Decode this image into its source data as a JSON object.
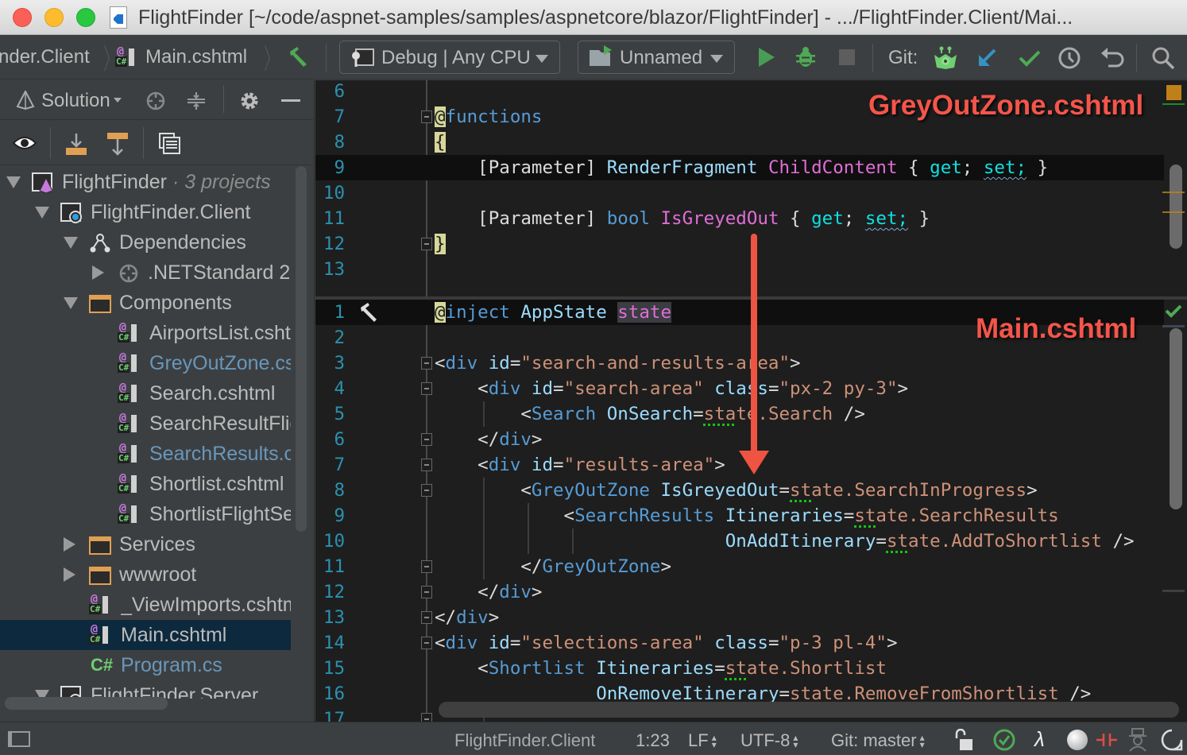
{
  "window": {
    "title": "FlightFinder [~/code/aspnet-samples/samples/aspnetcore/blazor/FlightFinder] - .../FlightFinder.Client/Mai..."
  },
  "toolbar": {
    "breadcrumbs": [
      "nder.Client",
      "Main.cshtml"
    ],
    "build_config": "Debug | Any CPU",
    "run_config": "Unnamed",
    "git_label": "Git:",
    "icons": [
      "build-hammer-icon",
      "run-icon",
      "debug-bug-icon",
      "stop-icon",
      "git-fetch-icon",
      "git-update-icon",
      "git-commit-icon",
      "git-history-icon",
      "git-revert-icon",
      "search-icon"
    ]
  },
  "solution_panel": {
    "title": "Solution",
    "tree": [
      {
        "label": "FlightFinder",
        "suffix": " · 3 projects",
        "level": 0,
        "arrow": "down",
        "icon": "solution-icon"
      },
      {
        "label": "FlightFinder.Client",
        "level": 1,
        "arrow": "down",
        "icon": "project-icon"
      },
      {
        "label": "Dependencies",
        "level": 2,
        "arrow": "down",
        "icon": "dependencies-icon"
      },
      {
        "label": ".NETStandard 2",
        "level": 3,
        "arrow": "right",
        "icon": "framework-icon"
      },
      {
        "label": "Components",
        "level": 2,
        "arrow": "down",
        "icon": "folder-icon"
      },
      {
        "label": "AirportsList.cshtml",
        "level": 4,
        "icon": "razor-file-icon"
      },
      {
        "label": "GreyOutZone.cshtml",
        "level": 4,
        "icon": "razor-file-icon",
        "modified": true
      },
      {
        "label": "Search.cshtml",
        "level": 4,
        "icon": "razor-file-icon"
      },
      {
        "label": "SearchResultFlight.cshtml",
        "level": 4,
        "icon": "razor-file-icon"
      },
      {
        "label": "SearchResults.cshtml",
        "level": 4,
        "icon": "razor-file-icon",
        "modified": true
      },
      {
        "label": "Shortlist.cshtml",
        "level": 4,
        "icon": "razor-file-icon"
      },
      {
        "label": "ShortlistFlightSegment.cshtml",
        "level": 4,
        "icon": "razor-file-icon"
      },
      {
        "label": "Services",
        "level": 2,
        "arrow": "right",
        "icon": "folder-icon"
      },
      {
        "label": "wwwroot",
        "level": 2,
        "arrow": "right",
        "icon": "folder-icon"
      },
      {
        "label": "_ViewImports.cshtml",
        "level": 3,
        "icon": "razor-file-icon"
      },
      {
        "label": "Main.cshtml",
        "level": 3,
        "icon": "razor-file-icon",
        "selected": true
      },
      {
        "label": "Program.cs",
        "level": 3,
        "icon": "csharp-file-icon",
        "modified": true
      },
      {
        "label": "FlightFinder.Server",
        "level": 1,
        "arrow": "down",
        "icon": "project-icon"
      }
    ]
  },
  "editor": {
    "top_pane": {
      "annotation": "GreyOutZone.cshtml",
      "lines": [
        {
          "n": "6",
          "tokens": []
        },
        {
          "n": "7",
          "fold": true,
          "tokens": [
            [
              "at",
              "@"
            ],
            [
              "kw",
              "functions"
            ]
          ]
        },
        {
          "n": "8",
          "tokens": [
            [
              "at",
              "{"
            ]
          ]
        },
        {
          "n": "9",
          "current": true,
          "tokens": [
            [
              "plain",
              "    [Parameter] "
            ],
            [
              "attr",
              "RenderFragment "
            ],
            [
              "pink",
              "ChildContent"
            ],
            [
              "plain",
              " { "
            ],
            [
              "cyan",
              "get"
            ],
            [
              "plain",
              "; "
            ],
            [
              "cyanwavy",
              "set;"
            ],
            [
              "plain",
              " }"
            ]
          ]
        },
        {
          "n": "10",
          "tokens": []
        },
        {
          "n": "11",
          "tokens": [
            [
              "plain",
              "    [Parameter] "
            ],
            [
              "kw",
              "bool "
            ],
            [
              "pink",
              "IsGreyedOut"
            ],
            [
              "plain",
              " { "
            ],
            [
              "cyan",
              "get"
            ],
            [
              "plain",
              "; "
            ],
            [
              "cyanwavy",
              "set;"
            ],
            [
              "plain",
              " }"
            ]
          ]
        },
        {
          "n": "12",
          "fold": true,
          "tokens": [
            [
              "at",
              "}"
            ]
          ]
        },
        {
          "n": "13",
          "tokens": []
        }
      ]
    },
    "bottom_pane": {
      "annotation": "Main.cshtml",
      "lines": [
        {
          "n": "1",
          "current": true,
          "hammer": true,
          "tokens": [
            [
              "at",
              "@"
            ],
            [
              "kw",
              "inject "
            ],
            [
              "attr",
              "AppState "
            ],
            [
              "pinkhl",
              "state"
            ]
          ]
        },
        {
          "n": "2",
          "tokens": []
        },
        {
          "n": "3",
          "fold": true,
          "tokens": [
            [
              "plain",
              "<"
            ],
            [
              "tag",
              "div "
            ],
            [
              "attr",
              "id"
            ],
            [
              "plain",
              "="
            ],
            [
              "str",
              "\"search-and-results-area\""
            ],
            [
              "plain",
              ">"
            ]
          ]
        },
        {
          "n": "4",
          "fold": true,
          "tokens": [
            [
              "plain",
              "    <"
            ],
            [
              "tag",
              "div "
            ],
            [
              "attr",
              "id"
            ],
            [
              "plain",
              "="
            ],
            [
              "str",
              "\"search-area\" "
            ],
            [
              "attr",
              "class"
            ],
            [
              "plain",
              "="
            ],
            [
              "str",
              "\"px-2 py-3\""
            ],
            [
              "plain",
              ">"
            ]
          ]
        },
        {
          "n": "5",
          "tokens": [
            [
              "plain",
              "        <"
            ],
            [
              "tag",
              "Search "
            ],
            [
              "attr",
              "OnSearch"
            ],
            [
              "plain",
              "="
            ],
            [
              "exprdot",
              "sta"
            ],
            [
              "expr",
              "te.Search "
            ],
            [
              "plain",
              "/>"
            ]
          ]
        },
        {
          "n": "6",
          "fold": true,
          "tokens": [
            [
              "plain",
              "    </"
            ],
            [
              "tag",
              "div"
            ],
            [
              "plain",
              ">"
            ]
          ]
        },
        {
          "n": "7",
          "fold": true,
          "tokens": [
            [
              "plain",
              "    <"
            ],
            [
              "tag",
              "div "
            ],
            [
              "attr",
              "id"
            ],
            [
              "plain",
              "="
            ],
            [
              "str",
              "\"results-area\""
            ],
            [
              "plain",
              ">"
            ]
          ]
        },
        {
          "n": "8",
          "fold": true,
          "tokens": [
            [
              "plain",
              "        <"
            ],
            [
              "tag",
              "GreyOutZone "
            ],
            [
              "attr",
              "IsGreyedOut"
            ],
            [
              "plain",
              "="
            ],
            [
              "exprdot",
              "st"
            ],
            [
              "expr",
              "ate.SearchInProgress"
            ],
            [
              "plain",
              ">"
            ]
          ]
        },
        {
          "n": "9",
          "tokens": [
            [
              "plain",
              "            <"
            ],
            [
              "tag",
              "SearchResults "
            ],
            [
              "attr",
              "Itineraries"
            ],
            [
              "plain",
              "="
            ],
            [
              "exprdot",
              "st"
            ],
            [
              "expr",
              "ate.SearchResults"
            ]
          ]
        },
        {
          "n": "10",
          "tokens": [
            [
              "plain",
              "                           "
            ],
            [
              "attr",
              "OnAddItinerary"
            ],
            [
              "plain",
              "="
            ],
            [
              "exprdot",
              "st"
            ],
            [
              "expr",
              "ate.AddToShortlist "
            ],
            [
              "plain",
              "/>"
            ]
          ]
        },
        {
          "n": "11",
          "fold": true,
          "tokens": [
            [
              "plain",
              "        </"
            ],
            [
              "tag",
              "GreyOutZone"
            ],
            [
              "plain",
              ">"
            ]
          ]
        },
        {
          "n": "12",
          "fold": true,
          "tokens": [
            [
              "plain",
              "    </"
            ],
            [
              "tag",
              "div"
            ],
            [
              "plain",
              ">"
            ]
          ]
        },
        {
          "n": "13",
          "fold": true,
          "tokens": [
            [
              "plain",
              "</"
            ],
            [
              "tag",
              "div"
            ],
            [
              "plain",
              ">"
            ]
          ]
        },
        {
          "n": "14",
          "fold": true,
          "tokens": [
            [
              "plain",
              "<"
            ],
            [
              "tag",
              "div "
            ],
            [
              "attr",
              "id"
            ],
            [
              "plain",
              "="
            ],
            [
              "str",
              "\"selections-area\" "
            ],
            [
              "attr",
              "class"
            ],
            [
              "plain",
              "="
            ],
            [
              "str",
              "\"p-3 pl-4\""
            ],
            [
              "plain",
              ">"
            ]
          ]
        },
        {
          "n": "15",
          "tokens": [
            [
              "plain",
              "    <"
            ],
            [
              "tag",
              "Shortlist "
            ],
            [
              "attr",
              "Itineraries"
            ],
            [
              "plain",
              "="
            ],
            [
              "exprdot",
              "st"
            ],
            [
              "expr",
              "ate.Shortlist"
            ]
          ]
        },
        {
          "n": "16",
          "tokens": [
            [
              "plain",
              "               "
            ],
            [
              "attr",
              "OnRemoveItinerary"
            ],
            [
              "plain",
              "="
            ],
            [
              "expr",
              "state.RemoveFromShortlist "
            ],
            [
              "plain",
              "/>"
            ]
          ]
        },
        {
          "n": "17",
          "fold": true,
          "tokens": []
        }
      ]
    }
  },
  "statusbar": {
    "project": "FlightFinder.Client",
    "position": "1:23",
    "line_ending": "LF",
    "encoding": "UTF-8",
    "git_branch": "Git: master",
    "icons": [
      "lock-icon",
      "inspection-ok-icon",
      "lambda-icon",
      "status-circle-icon",
      "breakpoint-icon",
      "spy-icon",
      "notifications-icon"
    ]
  },
  "colors": {
    "annotation": "#f5554a",
    "line_number": "#2b91af",
    "selected_row": "#0d293e",
    "modified_file": "#6897bb"
  }
}
